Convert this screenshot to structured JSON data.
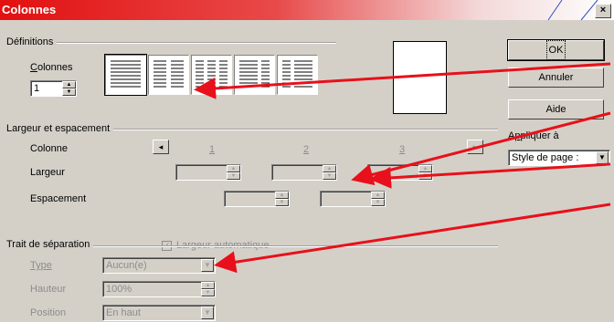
{
  "window": {
    "title": "Colonnes",
    "close_glyph": "×"
  },
  "definitions": {
    "group_label": "Définitions",
    "columns_label": "Colonnes",
    "columns_label_underline": "C",
    "columns_label_rest": "olonnes",
    "columns_value": "1",
    "layout_icons": [
      "one-column-icon",
      "two-columns-icon",
      "three-columns-icon",
      "two-columns-left-wide-icon",
      "two-columns-right-wide-icon"
    ]
  },
  "buttons": {
    "ok": "OK",
    "cancel": "Annuler",
    "help": "Aide"
  },
  "apply": {
    "label": "Appliquer à",
    "label_underline": "p",
    "value": "Style de page :"
  },
  "width_spacing": {
    "group_label": "Largeur et espacement",
    "column_label": "Colonne",
    "column_numbers": [
      "1",
      "2",
      "3"
    ],
    "width_label": "Largeur",
    "spacing_label": "Espacement",
    "auto_width_label": "Largeur automatique",
    "auto_width_checked": true
  },
  "separator": {
    "group_label": "Trait de séparation",
    "type_label": "Type",
    "type_value": "Aucun(e)",
    "height_label": "Hauteur",
    "height_value": "100%",
    "position_label": "Position",
    "position_value": "En haut"
  },
  "colors": {
    "title_red": "#e21010",
    "dialog_gray": "#d4d0c8",
    "annotation_red": "#e8101a"
  }
}
